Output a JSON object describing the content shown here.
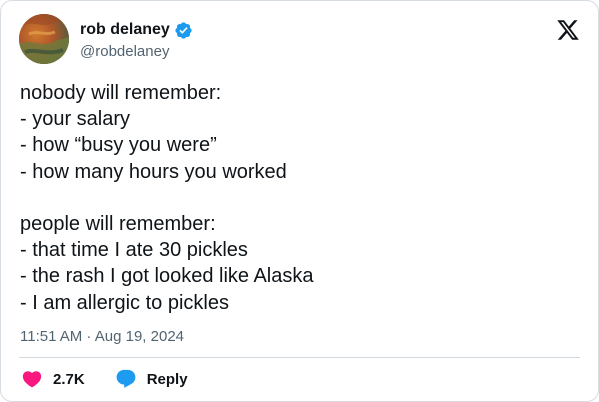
{
  "author": {
    "name": "rob delaney",
    "handle": "@robdelaney",
    "verified": true
  },
  "tweet": {
    "text": "nobody will remember:\n- your salary\n- how “busy you were”\n- how many hours you worked\n\npeople will remember:\n- that time I ate 30 pickles\n- the rash I got looked like Alaska\n- I am allergic to pickles",
    "timestamp": "11:51 AM · Aug 19, 2024"
  },
  "actions": {
    "like_count": "2.7K",
    "reply_label": "Reply"
  },
  "icons": {
    "logo": "x-logo-icon",
    "verified": "verified-badge-icon",
    "like": "heart-icon",
    "reply": "speech-bubble-icon"
  },
  "colors": {
    "verified_blue": "#1d9bf0",
    "like_pink": "#f91880",
    "reply_blue": "#1d9bf0",
    "secondary_text": "#536471"
  }
}
